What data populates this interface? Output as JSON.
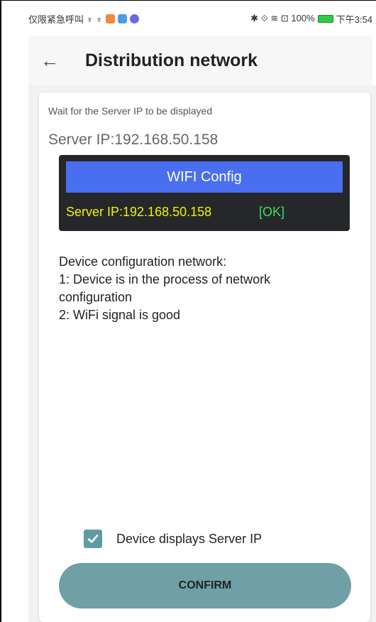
{
  "status_bar": {
    "left_text": "仅限紧急呼叫 ♆ ♆",
    "right_text": "✱ ⟐ ≋ ⊡ 100%",
    "time": "下午3:54"
  },
  "app_bar": {
    "back_icon": "←",
    "title": "Distribution network"
  },
  "main": {
    "hint": "Wait for the Server IP to be displayed",
    "server_ip": "Server IP:192.168.50.158",
    "device_screen": {
      "button_label": "WIFI Config",
      "ip_text": "Server IP:192.168.50.158",
      "ok_text": "[OK]"
    },
    "description": [
      "Device configuration network:",
      "1: Device is in the process of network",
      "configuration",
      "2: WiFi signal is good"
    ],
    "checkbox_label": "Device displays Server IP",
    "checkbox_checked": true,
    "confirm_label": "CONFIRM"
  },
  "colors": {
    "accent": "#6fa0a6",
    "checkbox": "#5e9ca3",
    "wifi_button": "#4a6ef0",
    "device_ip_text": "#f4f200",
    "ok_text": "#3ce05a"
  }
}
